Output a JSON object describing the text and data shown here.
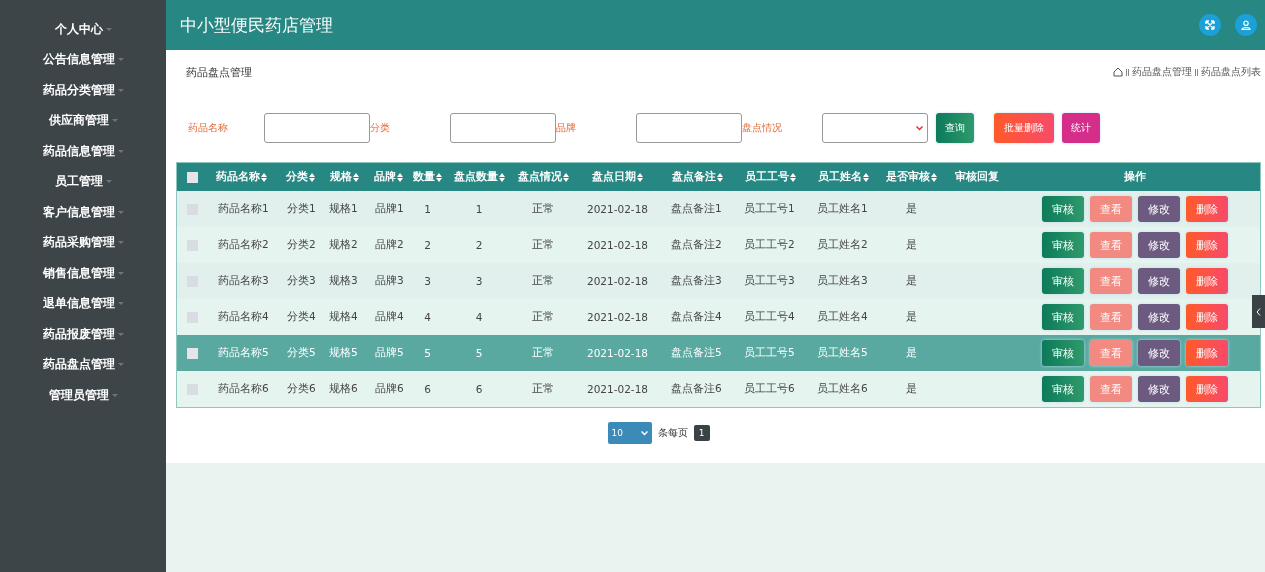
{
  "sidebar": {
    "items": [
      {
        "label": "个人中心"
      },
      {
        "label": "公告信息管理"
      },
      {
        "label": "药品分类管理"
      },
      {
        "label": "供应商管理"
      },
      {
        "label": "药品信息管理"
      },
      {
        "label": "员工管理"
      },
      {
        "label": "客户信息管理"
      },
      {
        "label": "药品采购管理"
      },
      {
        "label": "销售信息管理"
      },
      {
        "label": "退单信息管理"
      },
      {
        "label": "药品报废管理"
      },
      {
        "label": "药品盘点管理"
      },
      {
        "label": "管理员管理"
      }
    ]
  },
  "header": {
    "title": "中小型便民药店管理"
  },
  "page": {
    "title": "药品盘点管理",
    "breadcrumb": [
      "药品盘点管理",
      "药品盘点列表"
    ]
  },
  "filters": [
    {
      "label": "药品名称",
      "kind": "text"
    },
    {
      "label": "分类",
      "kind": "text"
    },
    {
      "label": "品牌",
      "kind": "text"
    },
    {
      "label": "盘点情况",
      "kind": "select"
    }
  ],
  "actions": [
    {
      "label": "查询",
      "kind": "query"
    },
    {
      "label": "批量删除",
      "kind": "delete"
    },
    {
      "label": "统计",
      "kind": "stats"
    }
  ],
  "table": {
    "select_all": {
      "checked": false
    },
    "columns": [
      {
        "label": "药品名称",
        "sortable": true
      },
      {
        "label": "分类",
        "sortable": true
      },
      {
        "label": "规格",
        "sortable": true
      },
      {
        "label": "品牌",
        "sortable": true
      },
      {
        "label": "数量",
        "sortable": true
      },
      {
        "label": "盘点数量",
        "sortable": true
      },
      {
        "label": "盘点情况",
        "sortable": true
      },
      {
        "label": "盘点日期",
        "sortable": true
      },
      {
        "label": "盘点备注",
        "sortable": true
      },
      {
        "label": "员工工号",
        "sortable": true
      },
      {
        "label": "员工姓名",
        "sortable": true
      },
      {
        "label": "是否审核",
        "sortable": true
      },
      {
        "label": "审核回复",
        "sortable": false
      },
      {
        "label": "操作",
        "sortable": false
      }
    ],
    "rows": [
      {
        "selected": false,
        "checked": false,
        "cells": [
          "药品名称1",
          "分类1",
          "规格1",
          "品牌1",
          "1",
          "1",
          "正常",
          "2021-02-18",
          "盘点备注1",
          "员工工号1",
          "员工姓名1",
          "是"
        ],
        "buttons": [
          {
            "label": "审核",
            "kind": "review"
          },
          {
            "label": "查看",
            "kind": "view"
          },
          {
            "label": "修改",
            "kind": "edit"
          },
          {
            "label": "删除",
            "kind": "delete"
          }
        ]
      },
      {
        "selected": false,
        "checked": false,
        "cells": [
          "药品名称2",
          "分类2",
          "规格2",
          "品牌2",
          "2",
          "2",
          "正常",
          "2021-02-18",
          "盘点备注2",
          "员工工号2",
          "员工姓名2",
          "是"
        ],
        "buttons": [
          {
            "label": "审核",
            "kind": "review"
          },
          {
            "label": "查看",
            "kind": "view"
          },
          {
            "label": "修改",
            "kind": "edit"
          },
          {
            "label": "删除",
            "kind": "delete"
          }
        ]
      },
      {
        "selected": false,
        "checked": false,
        "cells": [
          "药品名称3",
          "分类3",
          "规格3",
          "品牌3",
          "3",
          "3",
          "正常",
          "2021-02-18",
          "盘点备注3",
          "员工工号3",
          "员工姓名3",
          "是"
        ],
        "buttons": [
          {
            "label": "审核",
            "kind": "review"
          },
          {
            "label": "查看",
            "kind": "view"
          },
          {
            "label": "修改",
            "kind": "edit"
          },
          {
            "label": "删除",
            "kind": "delete"
          }
        ]
      },
      {
        "selected": false,
        "checked": false,
        "cells": [
          "药品名称4",
          "分类4",
          "规格4",
          "品牌4",
          "4",
          "4",
          "正常",
          "2021-02-18",
          "盘点备注4",
          "员工工号4",
          "员工姓名4",
          "是"
        ],
        "buttons": [
          {
            "label": "审核",
            "kind": "review"
          },
          {
            "label": "查看",
            "kind": "view"
          },
          {
            "label": "修改",
            "kind": "edit"
          },
          {
            "label": "删除",
            "kind": "delete"
          }
        ]
      },
      {
        "selected": true,
        "checked": false,
        "cells": [
          "药品名称5",
          "分类5",
          "规格5",
          "品牌5",
          "5",
          "5",
          "正常",
          "2021-02-18",
          "盘点备注5",
          "员工工号5",
          "员工姓名5",
          "是"
        ],
        "buttons": [
          {
            "label": "审核",
            "kind": "review"
          },
          {
            "label": "查看",
            "kind": "view"
          },
          {
            "label": "修改",
            "kind": "edit"
          },
          {
            "label": "删除",
            "kind": "delete"
          }
        ]
      },
      {
        "selected": false,
        "checked": false,
        "cells": [
          "药品名称6",
          "分类6",
          "规格6",
          "品牌6",
          "6",
          "6",
          "正常",
          "2021-02-18",
          "盘点备注6",
          "员工工号6",
          "员工姓名6",
          "是"
        ],
        "buttons": [
          {
            "label": "审核",
            "kind": "review"
          },
          {
            "label": "查看",
            "kind": "view"
          },
          {
            "label": "修改",
            "kind": "edit"
          },
          {
            "label": "删除",
            "kind": "delete"
          }
        ]
      }
    ]
  },
  "pagination": {
    "page_size": "10",
    "per_page_label": "条每页",
    "pages": [
      {
        "label": "1",
        "selected": true
      }
    ]
  }
}
